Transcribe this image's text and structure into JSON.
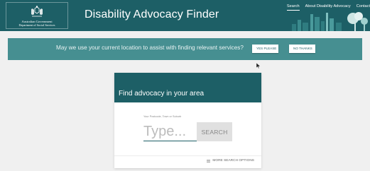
{
  "header": {
    "gov_name_line1": "Australian Government",
    "gov_name_line2": "Department of Social Services",
    "site_title": "Disability Advocacy Finder",
    "nav": [
      {
        "label": "Search"
      },
      {
        "label": "About Disability Advocacy"
      },
      {
        "label": "Contact"
      }
    ],
    "active_nav": "Search"
  },
  "banner": {
    "question": "May we use your current location to assist with finding relevant services?",
    "yes_label": "YES PLEASE",
    "no_label": "NO THANKS"
  },
  "search_card": {
    "title": "Find advocacy in your area",
    "field_label": "Your Postcode, Town or Suburb",
    "input_placeholder": "Type...",
    "input_value": "",
    "search_label": "SEARCH",
    "more_options_label": "MORE SEARCH OPTIONS"
  },
  "colors": {
    "header": "#1d5f66",
    "banner": "#468f91",
    "page_bg": "#f0f0f0"
  },
  "icons": {
    "logo": "coat-of-arms-icon",
    "more_options": "filter-icon",
    "cursor": "mouse-cursor-icon"
  }
}
